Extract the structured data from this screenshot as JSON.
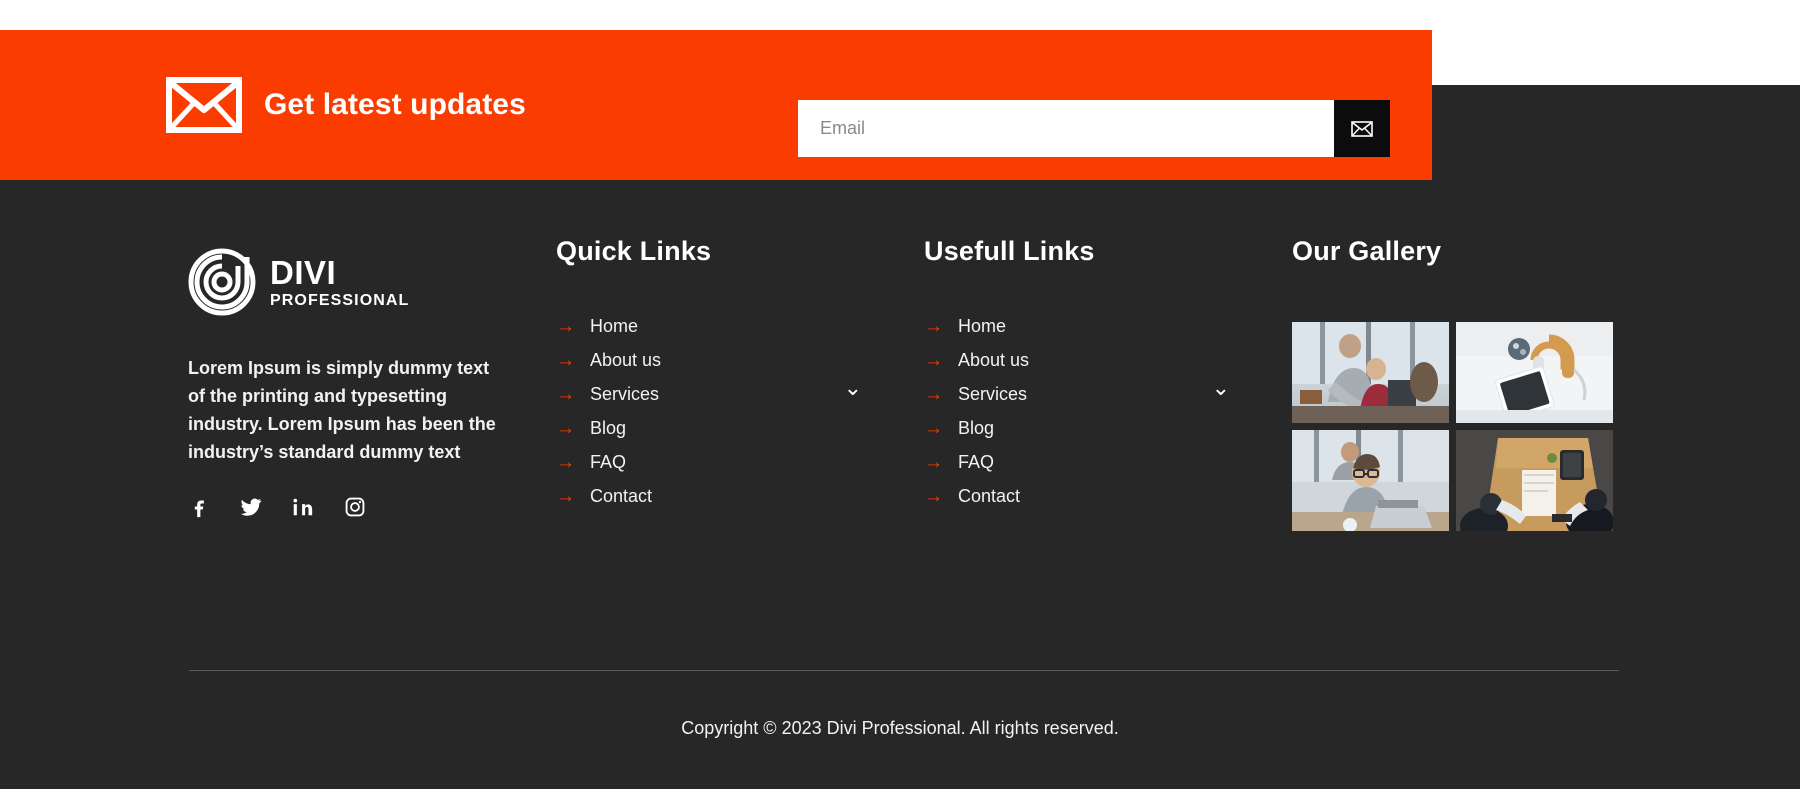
{
  "theme": {
    "accent_orange": "#FA3C00",
    "footer_dark": "#272727",
    "button_black": "#0C0C0C",
    "text_light": "#F2F2F2"
  },
  "newsletter": {
    "heading": "Get latest updates",
    "envelope_icon": "envelope-icon",
    "email_placeholder": "Email",
    "email_value": "",
    "submit_icon": "envelope-send-icon"
  },
  "brand": {
    "logo_mark": "divi-spiral-logo-icon",
    "logo_primary": "DIVI",
    "logo_secondary": "PROFESSIONAL",
    "description": "Lorem Ipsum is simply dummy text of the printing and typesetting industry. Lorem Ipsum has been the industry’s standard dummy text",
    "social": [
      {
        "name": "facebook-icon",
        "label": "Facebook"
      },
      {
        "name": "twitter-icon",
        "label": "Twitter"
      },
      {
        "name": "linkedin-icon",
        "label": "LinkedIn"
      },
      {
        "name": "instagram-icon",
        "label": "Instagram"
      }
    ]
  },
  "quick_links": {
    "title": "Quick Links",
    "bullet": "→",
    "items": [
      {
        "label": "Home",
        "has_submenu": false
      },
      {
        "label": "About us",
        "has_submenu": false
      },
      {
        "label": "Services",
        "has_submenu": true
      },
      {
        "label": "Blog",
        "has_submenu": false
      },
      {
        "label": "FAQ",
        "has_submenu": false
      },
      {
        "label": "Contact",
        "has_submenu": false
      }
    ]
  },
  "useful_links": {
    "title": "Usefull Links",
    "bullet": "→",
    "items": [
      {
        "label": "Home",
        "has_submenu": false
      },
      {
        "label": "About us",
        "has_submenu": false
      },
      {
        "label": "Services",
        "has_submenu": true
      },
      {
        "label": "Blog",
        "has_submenu": false
      },
      {
        "label": "FAQ",
        "has_submenu": false
      },
      {
        "label": "Contact",
        "has_submenu": false
      }
    ]
  },
  "gallery": {
    "title": "Our Gallery",
    "items": [
      {
        "alt": "office-colleagues-at-window-desk"
      },
      {
        "alt": "headphones-and-tablet-flatlay"
      },
      {
        "alt": "man-with-glasses-working-on-laptop"
      },
      {
        "alt": "overhead-desk-meeting-notebook"
      }
    ]
  },
  "footer_bottom": {
    "copyright": "Copyright © 2023 Divi Professional. All rights reserved."
  }
}
